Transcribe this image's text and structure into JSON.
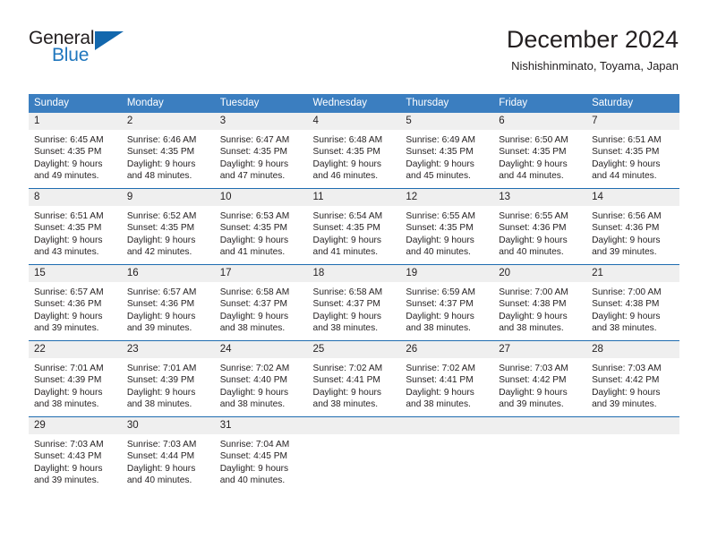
{
  "brand": {
    "name_part1": "General",
    "name_part2": "Blue"
  },
  "header": {
    "title": "December 2024",
    "location": "Nishishinminato, Toyama, Japan"
  },
  "calendar": {
    "weekday_headers": [
      "Sunday",
      "Monday",
      "Tuesday",
      "Wednesday",
      "Thursday",
      "Friday",
      "Saturday"
    ],
    "accent_color": "#3b7ec0",
    "rule_color": "#1f6cb0",
    "daynum_band_color": "#efefef",
    "weeks": [
      [
        {
          "day": "1",
          "sunrise": "Sunrise: 6:45 AM",
          "sunset": "Sunset: 4:35 PM",
          "daylight_line1": "Daylight: 9 hours",
          "daylight_line2": "and 49 minutes."
        },
        {
          "day": "2",
          "sunrise": "Sunrise: 6:46 AM",
          "sunset": "Sunset: 4:35 PM",
          "daylight_line1": "Daylight: 9 hours",
          "daylight_line2": "and 48 minutes."
        },
        {
          "day": "3",
          "sunrise": "Sunrise: 6:47 AM",
          "sunset": "Sunset: 4:35 PM",
          "daylight_line1": "Daylight: 9 hours",
          "daylight_line2": "and 47 minutes."
        },
        {
          "day": "4",
          "sunrise": "Sunrise: 6:48 AM",
          "sunset": "Sunset: 4:35 PM",
          "daylight_line1": "Daylight: 9 hours",
          "daylight_line2": "and 46 minutes."
        },
        {
          "day": "5",
          "sunrise": "Sunrise: 6:49 AM",
          "sunset": "Sunset: 4:35 PM",
          "daylight_line1": "Daylight: 9 hours",
          "daylight_line2": "and 45 minutes."
        },
        {
          "day": "6",
          "sunrise": "Sunrise: 6:50 AM",
          "sunset": "Sunset: 4:35 PM",
          "daylight_line1": "Daylight: 9 hours",
          "daylight_line2": "and 44 minutes."
        },
        {
          "day": "7",
          "sunrise": "Sunrise: 6:51 AM",
          "sunset": "Sunset: 4:35 PM",
          "daylight_line1": "Daylight: 9 hours",
          "daylight_line2": "and 44 minutes."
        }
      ],
      [
        {
          "day": "8",
          "sunrise": "Sunrise: 6:51 AM",
          "sunset": "Sunset: 4:35 PM",
          "daylight_line1": "Daylight: 9 hours",
          "daylight_line2": "and 43 minutes."
        },
        {
          "day": "9",
          "sunrise": "Sunrise: 6:52 AM",
          "sunset": "Sunset: 4:35 PM",
          "daylight_line1": "Daylight: 9 hours",
          "daylight_line2": "and 42 minutes."
        },
        {
          "day": "10",
          "sunrise": "Sunrise: 6:53 AM",
          "sunset": "Sunset: 4:35 PM",
          "daylight_line1": "Daylight: 9 hours",
          "daylight_line2": "and 41 minutes."
        },
        {
          "day": "11",
          "sunrise": "Sunrise: 6:54 AM",
          "sunset": "Sunset: 4:35 PM",
          "daylight_line1": "Daylight: 9 hours",
          "daylight_line2": "and 41 minutes."
        },
        {
          "day": "12",
          "sunrise": "Sunrise: 6:55 AM",
          "sunset": "Sunset: 4:35 PM",
          "daylight_line1": "Daylight: 9 hours",
          "daylight_line2": "and 40 minutes."
        },
        {
          "day": "13",
          "sunrise": "Sunrise: 6:55 AM",
          "sunset": "Sunset: 4:36 PM",
          "daylight_line1": "Daylight: 9 hours",
          "daylight_line2": "and 40 minutes."
        },
        {
          "day": "14",
          "sunrise": "Sunrise: 6:56 AM",
          "sunset": "Sunset: 4:36 PM",
          "daylight_line1": "Daylight: 9 hours",
          "daylight_line2": "and 39 minutes."
        }
      ],
      [
        {
          "day": "15",
          "sunrise": "Sunrise: 6:57 AM",
          "sunset": "Sunset: 4:36 PM",
          "daylight_line1": "Daylight: 9 hours",
          "daylight_line2": "and 39 minutes."
        },
        {
          "day": "16",
          "sunrise": "Sunrise: 6:57 AM",
          "sunset": "Sunset: 4:36 PM",
          "daylight_line1": "Daylight: 9 hours",
          "daylight_line2": "and 39 minutes."
        },
        {
          "day": "17",
          "sunrise": "Sunrise: 6:58 AM",
          "sunset": "Sunset: 4:37 PM",
          "daylight_line1": "Daylight: 9 hours",
          "daylight_line2": "and 38 minutes."
        },
        {
          "day": "18",
          "sunrise": "Sunrise: 6:58 AM",
          "sunset": "Sunset: 4:37 PM",
          "daylight_line1": "Daylight: 9 hours",
          "daylight_line2": "and 38 minutes."
        },
        {
          "day": "19",
          "sunrise": "Sunrise: 6:59 AM",
          "sunset": "Sunset: 4:37 PM",
          "daylight_line1": "Daylight: 9 hours",
          "daylight_line2": "and 38 minutes."
        },
        {
          "day": "20",
          "sunrise": "Sunrise: 7:00 AM",
          "sunset": "Sunset: 4:38 PM",
          "daylight_line1": "Daylight: 9 hours",
          "daylight_line2": "and 38 minutes."
        },
        {
          "day": "21",
          "sunrise": "Sunrise: 7:00 AM",
          "sunset": "Sunset: 4:38 PM",
          "daylight_line1": "Daylight: 9 hours",
          "daylight_line2": "and 38 minutes."
        }
      ],
      [
        {
          "day": "22",
          "sunrise": "Sunrise: 7:01 AM",
          "sunset": "Sunset: 4:39 PM",
          "daylight_line1": "Daylight: 9 hours",
          "daylight_line2": "and 38 minutes."
        },
        {
          "day": "23",
          "sunrise": "Sunrise: 7:01 AM",
          "sunset": "Sunset: 4:39 PM",
          "daylight_line1": "Daylight: 9 hours",
          "daylight_line2": "and 38 minutes."
        },
        {
          "day": "24",
          "sunrise": "Sunrise: 7:02 AM",
          "sunset": "Sunset: 4:40 PM",
          "daylight_line1": "Daylight: 9 hours",
          "daylight_line2": "and 38 minutes."
        },
        {
          "day": "25",
          "sunrise": "Sunrise: 7:02 AM",
          "sunset": "Sunset: 4:41 PM",
          "daylight_line1": "Daylight: 9 hours",
          "daylight_line2": "and 38 minutes."
        },
        {
          "day": "26",
          "sunrise": "Sunrise: 7:02 AM",
          "sunset": "Sunset: 4:41 PM",
          "daylight_line1": "Daylight: 9 hours",
          "daylight_line2": "and 38 minutes."
        },
        {
          "day": "27",
          "sunrise": "Sunrise: 7:03 AM",
          "sunset": "Sunset: 4:42 PM",
          "daylight_line1": "Daylight: 9 hours",
          "daylight_line2": "and 39 minutes."
        },
        {
          "day": "28",
          "sunrise": "Sunrise: 7:03 AM",
          "sunset": "Sunset: 4:42 PM",
          "daylight_line1": "Daylight: 9 hours",
          "daylight_line2": "and 39 minutes."
        }
      ],
      [
        {
          "day": "29",
          "sunrise": "Sunrise: 7:03 AM",
          "sunset": "Sunset: 4:43 PM",
          "daylight_line1": "Daylight: 9 hours",
          "daylight_line2": "and 39 minutes."
        },
        {
          "day": "30",
          "sunrise": "Sunrise: 7:03 AM",
          "sunset": "Sunset: 4:44 PM",
          "daylight_line1": "Daylight: 9 hours",
          "daylight_line2": "and 40 minutes."
        },
        {
          "day": "31",
          "sunrise": "Sunrise: 7:04 AM",
          "sunset": "Sunset: 4:45 PM",
          "daylight_line1": "Daylight: 9 hours",
          "daylight_line2": "and 40 minutes."
        },
        {
          "day": "",
          "sunrise": "",
          "sunset": "",
          "daylight_line1": "",
          "daylight_line2": ""
        },
        {
          "day": "",
          "sunrise": "",
          "sunset": "",
          "daylight_line1": "",
          "daylight_line2": ""
        },
        {
          "day": "",
          "sunrise": "",
          "sunset": "",
          "daylight_line1": "",
          "daylight_line2": ""
        },
        {
          "day": "",
          "sunrise": "",
          "sunset": "",
          "daylight_line1": "",
          "daylight_line2": ""
        }
      ]
    ]
  }
}
